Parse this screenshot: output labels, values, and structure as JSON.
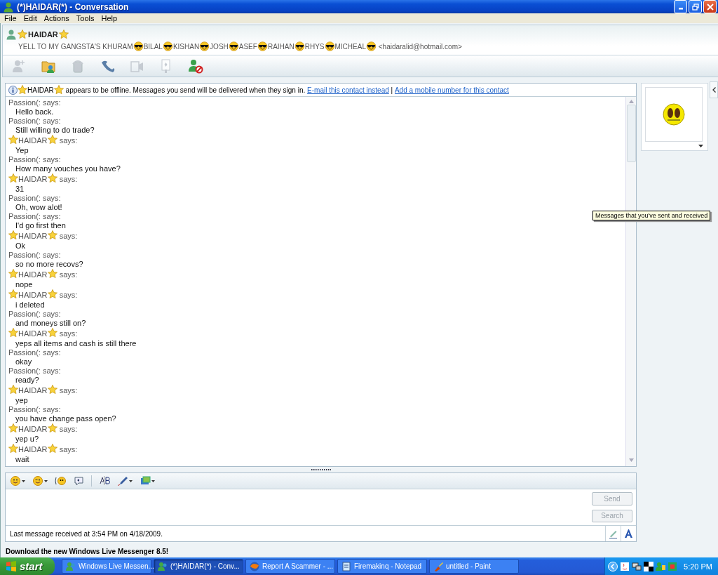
{
  "window": {
    "title": "(*)HAIDAR(*) - Conversation"
  },
  "menu": [
    "File",
    "Edit",
    "Actions",
    "Tools",
    "Help"
  ],
  "contact": {
    "name": "HAIDAR",
    "segments": [
      "YELL TO MY GANGSTA'S KHURAM",
      "BILAL",
      "KISHAN",
      "JOSH",
      "ASEF",
      "RAIHAN",
      "RHYS",
      "MICHEAL"
    ],
    "email": "<haidaralid@hotmail.com>"
  },
  "toolbar": [
    {
      "kind": "invite",
      "disabled": true
    },
    {
      "kind": "files",
      "disabled": false
    },
    {
      "kind": "voice",
      "disabled": true
    },
    {
      "kind": "call",
      "disabled": false
    },
    {
      "kind": "video",
      "disabled": true
    },
    {
      "kind": "games",
      "disabled": true
    },
    {
      "kind": "block",
      "disabled": false
    }
  ],
  "info_bar": {
    "name": "HAIDAR",
    "message": "appears to be offline. Messages you send will be delivered when they sign in.",
    "links": [
      "E-mail this contact instead",
      "Add a mobile number for this contact"
    ],
    "separator": "|"
  },
  "messages": [
    {
      "kind": "self",
      "sender": "Passion(:",
      "says": "says:",
      "text": "Hello back."
    },
    {
      "kind": "self",
      "sender": "Passion(:",
      "says": "says:",
      "text": "Still willing to do trade?"
    },
    {
      "kind": "contact",
      "sender": "HAIDAR",
      "says": "says:",
      "text": "Yep"
    },
    {
      "kind": "self",
      "sender": "Passion(:",
      "says": "says:",
      "text": "How many vouches you have?"
    },
    {
      "kind": "contact",
      "sender": "HAIDAR",
      "says": "says:",
      "text": "31"
    },
    {
      "kind": "self",
      "sender": "Passion(:",
      "says": "says:",
      "text": "Oh, wow alot!"
    },
    {
      "kind": "self",
      "sender": "Passion(:",
      "says": "says:",
      "text": "I'd go first then"
    },
    {
      "kind": "contact",
      "sender": "HAIDAR",
      "says": "says:",
      "text": "Ok"
    },
    {
      "kind": "self",
      "sender": "Passion(:",
      "says": "says:",
      "text": "so no more recovs?"
    },
    {
      "kind": "contact",
      "sender": "HAIDAR",
      "says": "says:",
      "text": "nope"
    },
    {
      "kind": "contact",
      "sender": "HAIDAR",
      "says": "says:",
      "text": "i deleted"
    },
    {
      "kind": "self",
      "sender": "Passion(:",
      "says": "says:",
      "text": "and moneys still on?"
    },
    {
      "kind": "contact",
      "sender": "HAIDAR",
      "says": "says:",
      "text": "yeps all items and cash is still there"
    },
    {
      "kind": "self",
      "sender": "Passion(:",
      "says": "says:",
      "text": "okay"
    },
    {
      "kind": "self",
      "sender": "Passion(:",
      "says": "says:",
      "text": "ready?"
    },
    {
      "kind": "contact",
      "sender": "HAIDAR",
      "says": "says:",
      "text": "yep"
    },
    {
      "kind": "self",
      "sender": "Passion(:",
      "says": "says:",
      "text": "you have change pass open?"
    },
    {
      "kind": "contact",
      "sender": "HAIDAR",
      "says": "says:",
      "text": "yep u?"
    },
    {
      "kind": "contact",
      "sender": "HAIDAR",
      "says": "says:",
      "text": "wait"
    }
  ],
  "tooltip": "Messages that you've sent and received",
  "compose_toolbar": [
    {
      "kind": "emoticon",
      "menu": true
    },
    {
      "kind": "wink",
      "menu": true
    },
    {
      "kind": "nudge",
      "menu": false
    },
    {
      "kind": "voice-clip",
      "menu": false
    },
    {
      "kind": "spelling",
      "menu": false
    },
    {
      "kind": "pen",
      "menu": true
    },
    {
      "kind": "background",
      "menu": true
    }
  ],
  "buttons": [
    {
      "label": "Send",
      "disabled": true
    },
    {
      "label": "Search",
      "disabled": true
    }
  ],
  "status": "Last message received at 3:54 PM on 4/18/2009.",
  "footer": "Download the new Windows Live Messenger 8.5!",
  "taskbar": {
    "start": "start",
    "tasks": [
      {
        "label": "Windows Live Messen...",
        "kind": "messenger",
        "selected": false
      },
      {
        "label": "(*)HAIDAR(*) - Conv...",
        "kind": "messenger",
        "selected": true
      },
      {
        "label": "Report A Scammer - ...",
        "kind": "browser",
        "selected": false
      },
      {
        "label": "Firemakinq - Notepad",
        "kind": "notepad",
        "selected": false
      },
      {
        "label": "untitled - Paint",
        "kind": "paint",
        "selected": false
      }
    ],
    "clock": "5:20 PM"
  }
}
